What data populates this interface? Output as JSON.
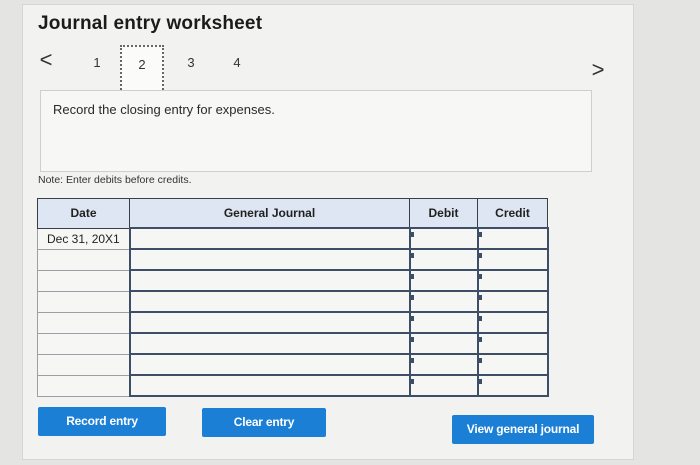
{
  "title": "Journal entry worksheet",
  "nav": {
    "prev_glyph": "<",
    "next_glyph": ">",
    "steps": [
      "1",
      "2",
      "3",
      "4"
    ],
    "active_step": "2"
  },
  "prompt": "Record the closing entry for expenses.",
  "note": "Note: Enter debits before credits.",
  "table": {
    "headers": {
      "date": "Date",
      "journal": "General Journal",
      "debit": "Debit",
      "credit": "Credit"
    },
    "rows": [
      {
        "date": "Dec 31, 20X1",
        "journal": "",
        "debit": "",
        "credit": ""
      },
      {
        "date": "",
        "journal": "",
        "debit": "",
        "credit": ""
      },
      {
        "date": "",
        "journal": "",
        "debit": "",
        "credit": ""
      },
      {
        "date": "",
        "journal": "",
        "debit": "",
        "credit": ""
      },
      {
        "date": "",
        "journal": "",
        "debit": "",
        "credit": ""
      },
      {
        "date": "",
        "journal": "",
        "debit": "",
        "credit": ""
      },
      {
        "date": "",
        "journal": "",
        "debit": "",
        "credit": ""
      },
      {
        "date": "",
        "journal": "",
        "debit": "",
        "credit": ""
      }
    ]
  },
  "buttons": {
    "record": "Record entry",
    "clear": "Clear entry",
    "view": "View general journal"
  },
  "colors": {
    "button": "#1b7fd6",
    "header": "#dde6f2"
  }
}
